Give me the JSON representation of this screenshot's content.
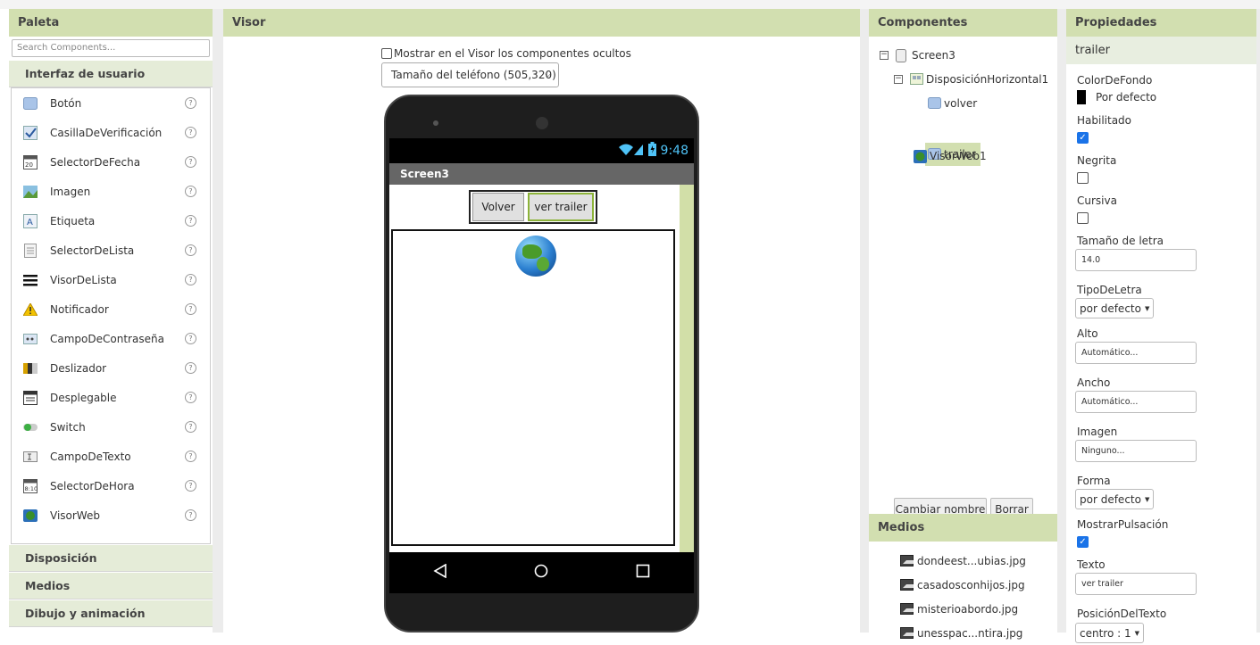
{
  "palette": {
    "title": "Paleta",
    "search_placeholder": "Search Components...",
    "category_open": "Interfaz de usuario",
    "items": [
      {
        "label": "Botón",
        "icon": "button-icon"
      },
      {
        "label": "CasillaDeVerificación",
        "icon": "checkbox-icon"
      },
      {
        "label": "SelectorDeFecha",
        "icon": "date-picker-icon"
      },
      {
        "label": "Imagen",
        "icon": "image-icon"
      },
      {
        "label": "Etiqueta",
        "icon": "label-icon"
      },
      {
        "label": "SelectorDeLista",
        "icon": "list-picker-icon"
      },
      {
        "label": "VisorDeLista",
        "icon": "list-view-icon"
      },
      {
        "label": "Notificador",
        "icon": "notifier-icon"
      },
      {
        "label": "CampoDeContraseña",
        "icon": "password-icon"
      },
      {
        "label": "Deslizador",
        "icon": "slider-icon"
      },
      {
        "label": "Desplegable",
        "icon": "spinner-icon"
      },
      {
        "label": "Switch",
        "icon": "switch-icon"
      },
      {
        "label": "CampoDeTexto",
        "icon": "textbox-icon"
      },
      {
        "label": "SelectorDeHora",
        "icon": "time-picker-icon"
      },
      {
        "label": "VisorWeb",
        "icon": "web-viewer-icon"
      }
    ],
    "help": "?",
    "categories_closed": [
      "Disposición",
      "Medios",
      "Dibujo y animación"
    ]
  },
  "visor": {
    "title": "Visor",
    "show_hidden_label": "Mostrar en el Visor los componentes ocultos",
    "size_select": "Tamaño del teléfono (505,320)",
    "phone": {
      "time": "9:48",
      "screen_title": "Screen3",
      "btn_volver": "Volver",
      "btn_trailer": "ver trailer"
    }
  },
  "components": {
    "title": "Componentes",
    "tree": {
      "screen": "Screen3",
      "harr": "DisposiciónHorizontal1",
      "btn1": "volver",
      "btn2": "trailer",
      "web": "VisorWeb1"
    },
    "rename_button": "Cambiar nombre",
    "delete_button": "Borrar"
  },
  "media": {
    "title": "Medios",
    "files": [
      "dondeest...ubias.jpg",
      "casadosconhijos.jpg",
      "misterioabordo.jpg",
      "unesspac...ntira.jpg"
    ]
  },
  "properties": {
    "title": "Propiedades",
    "selected": "trailer",
    "bgcolor_label": "ColorDeFondo",
    "bgcolor_value": "Por defecto",
    "enabled_label": "Habilitado",
    "enabled": true,
    "bold_label": "Negrita",
    "bold": false,
    "italic_label": "Cursiva",
    "italic": false,
    "fontsize_label": "Tamaño de letra",
    "fontsize_value": "14.0",
    "fonttype_label": "TipoDeLetra",
    "fonttype_value": "por defecto",
    "height_label": "Alto",
    "height_value": "Automático...",
    "width_label": "Ancho",
    "width_value": "Automático...",
    "image_label": "Imagen",
    "image_value": "Ninguno...",
    "shape_label": "Forma",
    "shape_value": "por defecto",
    "feedback_label": "MostrarPulsación",
    "feedback": true,
    "text_label": "Texto",
    "text_value": "ver trailer",
    "textpos_label": "PosiciónDelTexto",
    "textpos_value": "centro : 1"
  },
  "colors": {
    "header_bg": "#d2dfb0",
    "scroll_accent": "#d2dfa8"
  }
}
